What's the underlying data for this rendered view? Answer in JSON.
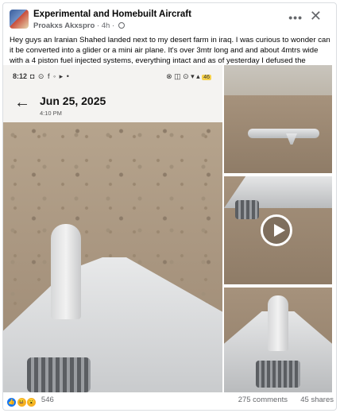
{
  "post": {
    "group_name": "Experimental and Homebuilt Aircraft",
    "author": "Proakxs Akxspro",
    "time_ago": "4h",
    "body": "Hey guys an Iranian Shahed landed next to my desert farm in iraq. I was curious to wonder can it be converted into a glider or a mini air plane. It's over 3mtr long and  and about 4mtrs wide with a 4 piston fuel injected systems, everything intact and as of yesterday I defused the warhead."
  },
  "icons": {
    "more": "more-horizontal-icon",
    "close": "close-icon",
    "globe": "globe-icon",
    "back": "back-arrow-icon",
    "play": "play-icon"
  },
  "phone": {
    "status_time": "8:12",
    "status_icons": "◘ ⊙ f ◦ ▸ •",
    "right_icons": "⊗ ◫ ⊙ ▾ ▴",
    "battery": "46",
    "date": "Jun 25, 2025",
    "time": "4:10 PM"
  },
  "footer": {
    "reaction_count": "546",
    "comments": "275 comments",
    "shares": "45 shares"
  },
  "colors": {
    "link": "#1877f2",
    "secondary_text": "#65676b",
    "border": "#dadde1"
  }
}
